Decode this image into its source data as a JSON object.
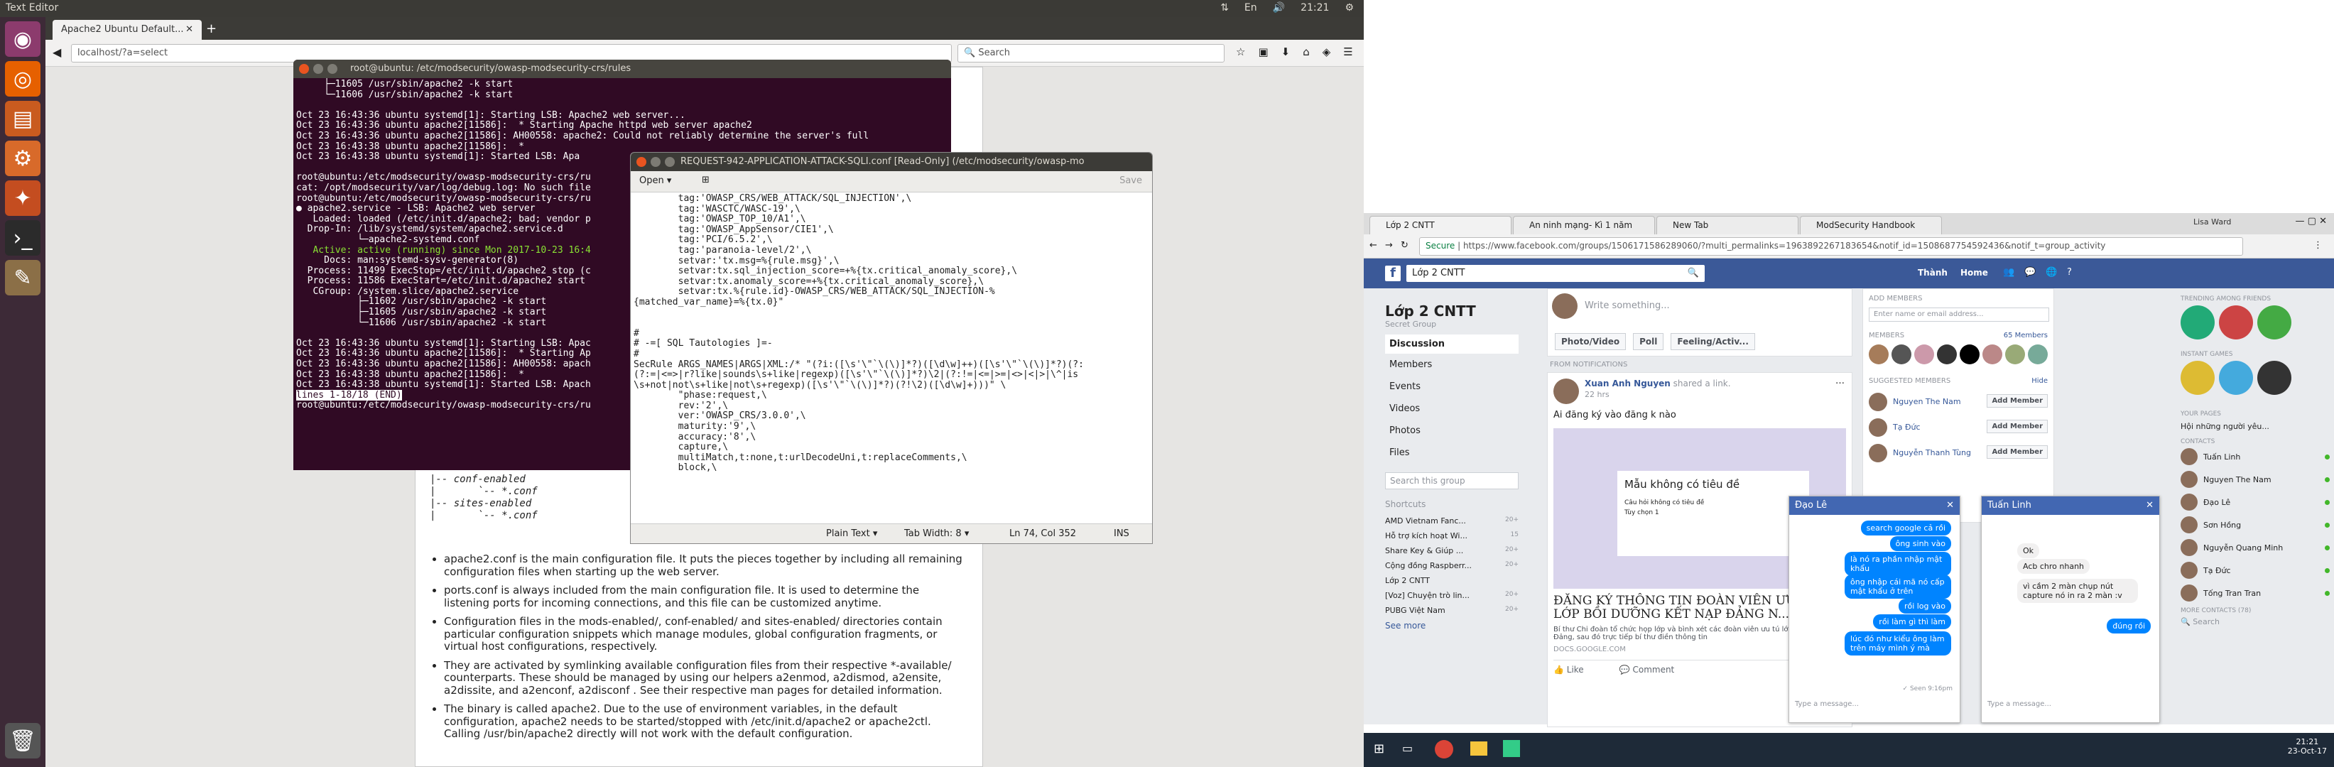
{
  "topbar": {
    "app_title": "Text Editor",
    "time": "21:21"
  },
  "firefox": {
    "tab_title": "Apache2 Ubuntu Default...",
    "url": "localhost/?a=select",
    "search_placeholder": "Search"
  },
  "terminal": {
    "title": "root@ubuntu: /etc/modsecurity/owasp-modsecurity-crs/rules",
    "lines": [
      "     ├─11605 /usr/sbin/apache2 -k start",
      "     └─11606 /usr/sbin/apache2 -k start",
      "",
      "Oct 23 16:43:36 ubuntu systemd[1]: Starting LSB: Apache2 web server...",
      "Oct 23 16:43:36 ubuntu apache2[11586]:  * Starting Apache httpd web server apache2",
      "Oct 23 16:43:36 ubuntu apache2[11586]: AH00558: apache2: Could not reliably determine the server's full",
      "Oct 23 16:43:38 ubuntu apache2[11586]:  *",
      "Oct 23 16:43:38 ubuntu systemd[1]: Started LSB: Apa",
      "",
      "root@ubuntu:/etc/modsecurity/owasp-modsecurity-crs/ru",
      "cat: /opt/modsecurity/var/log/debug.log: No such file",
      "root@ubuntu:/etc/modsecurity/owasp-modsecurity-crs/ru",
      "● apache2.service - LSB: Apache2 web server",
      "   Loaded: loaded (/etc/init.d/apache2; bad; vendor p",
      "  Drop-In: /lib/systemd/system/apache2.service.d",
      "           └─apache2-systemd.conf",
      "   Active: active (running) since Mon 2017-10-23 16:4",
      "     Docs: man:systemd-sysv-generator(8)",
      "  Process: 11499 ExecStop=/etc/init.d/apache2 stop (c",
      "  Process: 11586 ExecStart=/etc/init.d/apache2 start",
      "   CGroup: /system.slice/apache2.service",
      "           ├─11602 /usr/sbin/apache2 -k start",
      "           ├─11605 /usr/sbin/apache2 -k start",
      "           └─11606 /usr/sbin/apache2 -k start",
      "",
      "Oct 23 16:43:36 ubuntu systemd[1]: Starting LSB: Apac",
      "Oct 23 16:43:36 ubuntu apache2[11586]:  * Starting Ap",
      "Oct 23 16:43:36 ubuntu apache2[11586]: AH00558: apach",
      "Oct 23 16:43:38 ubuntu apache2[11586]:  *",
      "Oct 23 16:43:38 ubuntu systemd[1]: Started LSB: Apach",
      "lines 1-18/18 (END)",
      "root@ubuntu:/etc/modsecurity/owasp-modsecurity-crs/ru"
    ]
  },
  "editor": {
    "title": "REQUEST-942-APPLICATION-ATTACK-SQLI.conf [Read-Only] (/etc/modsecurity/owasp-mo",
    "open_label": "Open",
    "save_label": "Save",
    "lines": [
      "        tag:'OWASP_CRS/WEB_ATTACK/SQL_INJECTION',\\",
      "        tag:'WASCTC/WASC-19',\\",
      "        tag:'OWASP_TOP_10/A1',\\",
      "        tag:'OWASP_AppSensor/CIE1',\\",
      "        tag:'PCI/6.5.2',\\",
      "        tag:'paranoia-level/2',\\",
      "        setvar:'tx.msg=%{rule.msg}',\\",
      "        setvar:tx.sql_injection_score=+%{tx.critical_anomaly_score},\\",
      "        setvar:tx.anomaly_score=+%{tx.critical_anomaly_score},\\",
      "        setvar:tx.%{rule.id}-OWASP_CRS/WEB_ATTACK/SQL_INJECTION-%",
      "{matched_var_name}=%{tx.0}\"",
      "",
      "",
      "#",
      "# -=[ SQL Tautologies ]=-",
      "#",
      "SecRule ARGS_NAMES|ARGS|XML:/* \"(?i:([\\s'\\\"`\\(\\)]*?)([\\d\\w]++)([\\s'\\\"`\\(\\)]*?)(?:",
      "(?:=|<=>|r?like|sounds\\s+like|regexp)([\\s'\\\"`\\(\\)]*?)\\2|(?:!=|<=|>=|<>|<|>|\\^|is",
      "\\s+not|not\\s+like|not\\s+regexp)([\\s'\\\"`\\(\\)]*?)(?!\\2)([\\d\\w]+)))\" \\",
      "        \"phase:request,\\",
      "        rev:'2',\\",
      "        ver:'OWASP_CRS/3.0.0',\\",
      "        maturity:'9',\\",
      "        accuracy:'8',\\",
      "        capture,\\",
      "        multiMatch,t:none,t:urlDecodeUni,t:replaceComments,\\",
      "        block,\\"
    ],
    "status_lang": "Plain Text",
    "status_tab": "Tab Width: 8",
    "status_pos": "Ln 74, Col 352",
    "status_ins": "INS"
  },
  "doc": {
    "tree": [
      "|-- conf-enabled",
      "|       `-- *.conf",
      "|-- sites-enabled",
      "|       `-- *.conf"
    ],
    "bullets": [
      "apache2.conf is the main configuration file. It puts the pieces together by including all remaining configuration files when starting up the web server.",
      "ports.conf is always included from the main configuration file. It is used to determine the listening ports for incoming connections, and this file can be customized anytime.",
      "Configuration files in the mods-enabled/, conf-enabled/ and sites-enabled/ directories contain particular configuration snippets which manage modules, global configuration fragments, or virtual host configurations, respectively.",
      "They are activated by symlinking available configuration files from their respective *-available/ counterparts. These should be managed by using our helpers a2enmod, a2dismod, a2ensite, a2dissite, and a2enconf, a2disconf . See their respective man pages for detailed information.",
      "The binary is called apache2. Due to the use of environment variables, in the default configuration, apache2 needs to be started/stopped with /etc/init.d/apache2 or apache2ctl. Calling /usr/bin/apache2 directly will not work with the default configuration."
    ]
  },
  "chrome": {
    "tabs": [
      "Lớp 2 CNTT",
      "An ninh mạng- Kì 1 năm",
      "New Tab",
      "ModSecurity Handbook"
    ],
    "secure": "Secure",
    "url": "https://www.facebook.com/groups/1506171586289060/?multi_permalinks=1963892267183654&notif_id=1508687754592436&notif_t=group_activity",
    "profile": "Lisa Ward"
  },
  "facebook": {
    "search_value": "Lớp 2 CNTT",
    "user": "Thành",
    "home": "Home",
    "group_name": "Lớp 2 CNTT",
    "group_type": "Secret Group",
    "nav": [
      "Discussion",
      "Members",
      "Events",
      "Videos",
      "Photos",
      "Files"
    ],
    "search_group": "Search this group",
    "shortcuts_title": "Shortcuts",
    "shortcuts": [
      {
        "name": "AMD Vietnam Fanc...",
        "count": "20+"
      },
      {
        "name": "Hỗ trợ kích hoạt Wi...",
        "count": "15"
      },
      {
        "name": "Share Key & Giúp ...",
        "count": "20+"
      },
      {
        "name": "Cộng đồng Raspberr...",
        "count": "20+"
      },
      {
        "name": "Lớp 2 CNTT",
        "count": ""
      },
      {
        "name": "[Voz] Chuyện trò lin...",
        "count": "20+"
      },
      {
        "name": "PUBG Việt Nam",
        "count": "20+"
      }
    ],
    "see_more": "See more",
    "write_placeholder": "Write something...",
    "post_actions": [
      "Photo/Video",
      "Poll",
      "Feeling/Activ..."
    ],
    "from_notifications": "FROM NOTIFICATIONS",
    "post_author": "Xuan Anh Nguyen",
    "post_shared": "shared a link.",
    "post_time": "22 hrs",
    "post_text": "Ai đăng ký vào đăng k nào",
    "form_title": "Mẫu không có tiêu đề",
    "form_q": "Câu hỏi không có tiêu đề",
    "form_opt": "Tùy chọn 1",
    "link_title": "ĐĂNG KÝ THÔNG TIN ĐOÀN VIÊN ƯU TÚ LỚP BỒI DƯỠNG KẾT NẠP ĐẢNG N...",
    "link_desc": "Bí thư Chi đoàn tổ chức họp lớp và bình xét các đoàn viên ưu tú lớp Cảm tình Đảng, sau đó trực tiếp bí thư điền thông tin",
    "link_domain": "DOCS.GOOGLE.COM",
    "like": "Like",
    "comment": "Comment",
    "add_members": "ADD MEMBERS",
    "add_placeholder": "Enter name or email address...",
    "members_label": "MEMBERS",
    "members_count": "65 Members",
    "suggested": "SUGGESTED MEMBERS",
    "hide": "Hide",
    "suggested_list": [
      "Nguyen The Nam",
      "Tạ Đức",
      "Nguyễn Thanh Tùng"
    ],
    "add_member_btn": "Add Member",
    "trending": "TRENDING AMONG FRIENDS",
    "instant_games": "INSTANT GAMES",
    "your_pages": "YOUR PAGES",
    "page_item": "Hội những người yêu...",
    "contacts_title": "CONTACTS",
    "contacts": [
      "Tuấn Linh",
      "Nguyen The Nam",
      "Đạo Lê",
      "Sơn Hồng",
      "Nguyễn Quang Minh",
      "Tạ Đức",
      "Tống Tran Tran"
    ],
    "more_contacts": "MORE CONTACTS (78)",
    "search_contacts": "Search"
  },
  "chat1": {
    "name": "Đạo Lê",
    "messages": [
      "search google cả rồi",
      "ông sinh vào",
      "là nó ra phần nhập mật khẩu",
      "ông nhập cái mã nó cấp mật khẩu ở trên",
      "rồi log vào",
      "rồi làm gì thì làm",
      "lúc đó như kiểu ông làm trên máy mình ý mà"
    ],
    "seen": "✓ Seen 9:16pm",
    "placeholder": "Type a message..."
  },
  "chat2": {
    "name": "Tuấn Linh",
    "messages_in": [
      "Ok",
      "Acb chro nhanh",
      "vì cầm 2 màn chụp nút capture nó in ra 2 màn :v"
    ],
    "messages_out": [
      "đúng rồi"
    ],
    "placeholder": "Type a message..."
  },
  "taskbar": {
    "time": "21:21",
    "date": "23-Oct-17"
  }
}
